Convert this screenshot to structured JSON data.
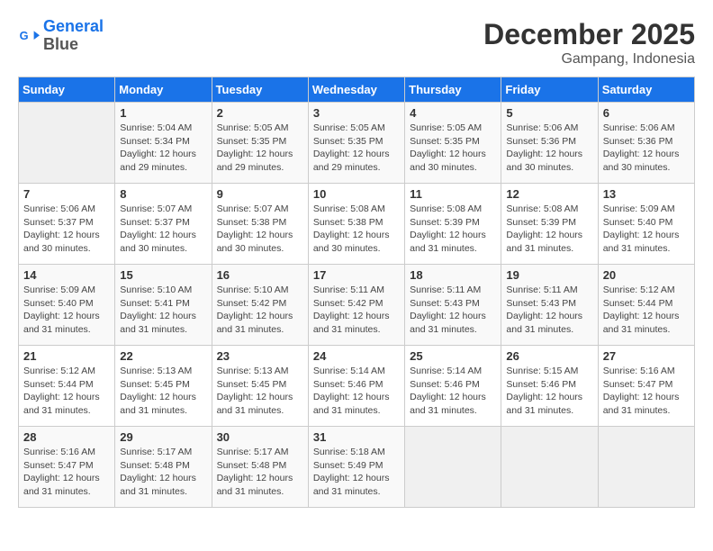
{
  "logo": {
    "line1": "General",
    "line2": "Blue"
  },
  "title": "December 2025",
  "subtitle": "Gampang, Indonesia",
  "days_of_week": [
    "Sunday",
    "Monday",
    "Tuesday",
    "Wednesday",
    "Thursday",
    "Friday",
    "Saturday"
  ],
  "weeks": [
    [
      {
        "day": "",
        "info": ""
      },
      {
        "day": "1",
        "info": "Sunrise: 5:04 AM\nSunset: 5:34 PM\nDaylight: 12 hours\nand 29 minutes."
      },
      {
        "day": "2",
        "info": "Sunrise: 5:05 AM\nSunset: 5:35 PM\nDaylight: 12 hours\nand 29 minutes."
      },
      {
        "day": "3",
        "info": "Sunrise: 5:05 AM\nSunset: 5:35 PM\nDaylight: 12 hours\nand 29 minutes."
      },
      {
        "day": "4",
        "info": "Sunrise: 5:05 AM\nSunset: 5:35 PM\nDaylight: 12 hours\nand 30 minutes."
      },
      {
        "day": "5",
        "info": "Sunrise: 5:06 AM\nSunset: 5:36 PM\nDaylight: 12 hours\nand 30 minutes."
      },
      {
        "day": "6",
        "info": "Sunrise: 5:06 AM\nSunset: 5:36 PM\nDaylight: 12 hours\nand 30 minutes."
      }
    ],
    [
      {
        "day": "7",
        "info": "Sunrise: 5:06 AM\nSunset: 5:37 PM\nDaylight: 12 hours\nand 30 minutes."
      },
      {
        "day": "8",
        "info": "Sunrise: 5:07 AM\nSunset: 5:37 PM\nDaylight: 12 hours\nand 30 minutes."
      },
      {
        "day": "9",
        "info": "Sunrise: 5:07 AM\nSunset: 5:38 PM\nDaylight: 12 hours\nand 30 minutes."
      },
      {
        "day": "10",
        "info": "Sunrise: 5:08 AM\nSunset: 5:38 PM\nDaylight: 12 hours\nand 30 minutes."
      },
      {
        "day": "11",
        "info": "Sunrise: 5:08 AM\nSunset: 5:39 PM\nDaylight: 12 hours\nand 31 minutes."
      },
      {
        "day": "12",
        "info": "Sunrise: 5:08 AM\nSunset: 5:39 PM\nDaylight: 12 hours\nand 31 minutes."
      },
      {
        "day": "13",
        "info": "Sunrise: 5:09 AM\nSunset: 5:40 PM\nDaylight: 12 hours\nand 31 minutes."
      }
    ],
    [
      {
        "day": "14",
        "info": "Sunrise: 5:09 AM\nSunset: 5:40 PM\nDaylight: 12 hours\nand 31 minutes."
      },
      {
        "day": "15",
        "info": "Sunrise: 5:10 AM\nSunset: 5:41 PM\nDaylight: 12 hours\nand 31 minutes."
      },
      {
        "day": "16",
        "info": "Sunrise: 5:10 AM\nSunset: 5:42 PM\nDaylight: 12 hours\nand 31 minutes."
      },
      {
        "day": "17",
        "info": "Sunrise: 5:11 AM\nSunset: 5:42 PM\nDaylight: 12 hours\nand 31 minutes."
      },
      {
        "day": "18",
        "info": "Sunrise: 5:11 AM\nSunset: 5:43 PM\nDaylight: 12 hours\nand 31 minutes."
      },
      {
        "day": "19",
        "info": "Sunrise: 5:11 AM\nSunset: 5:43 PM\nDaylight: 12 hours\nand 31 minutes."
      },
      {
        "day": "20",
        "info": "Sunrise: 5:12 AM\nSunset: 5:44 PM\nDaylight: 12 hours\nand 31 minutes."
      }
    ],
    [
      {
        "day": "21",
        "info": "Sunrise: 5:12 AM\nSunset: 5:44 PM\nDaylight: 12 hours\nand 31 minutes."
      },
      {
        "day": "22",
        "info": "Sunrise: 5:13 AM\nSunset: 5:45 PM\nDaylight: 12 hours\nand 31 minutes."
      },
      {
        "day": "23",
        "info": "Sunrise: 5:13 AM\nSunset: 5:45 PM\nDaylight: 12 hours\nand 31 minutes."
      },
      {
        "day": "24",
        "info": "Sunrise: 5:14 AM\nSunset: 5:46 PM\nDaylight: 12 hours\nand 31 minutes."
      },
      {
        "day": "25",
        "info": "Sunrise: 5:14 AM\nSunset: 5:46 PM\nDaylight: 12 hours\nand 31 minutes."
      },
      {
        "day": "26",
        "info": "Sunrise: 5:15 AM\nSunset: 5:46 PM\nDaylight: 12 hours\nand 31 minutes."
      },
      {
        "day": "27",
        "info": "Sunrise: 5:16 AM\nSunset: 5:47 PM\nDaylight: 12 hours\nand 31 minutes."
      }
    ],
    [
      {
        "day": "28",
        "info": "Sunrise: 5:16 AM\nSunset: 5:47 PM\nDaylight: 12 hours\nand 31 minutes."
      },
      {
        "day": "29",
        "info": "Sunrise: 5:17 AM\nSunset: 5:48 PM\nDaylight: 12 hours\nand 31 minutes."
      },
      {
        "day": "30",
        "info": "Sunrise: 5:17 AM\nSunset: 5:48 PM\nDaylight: 12 hours\nand 31 minutes."
      },
      {
        "day": "31",
        "info": "Sunrise: 5:18 AM\nSunset: 5:49 PM\nDaylight: 12 hours\nand 31 minutes."
      },
      {
        "day": "",
        "info": ""
      },
      {
        "day": "",
        "info": ""
      },
      {
        "day": "",
        "info": ""
      }
    ]
  ]
}
